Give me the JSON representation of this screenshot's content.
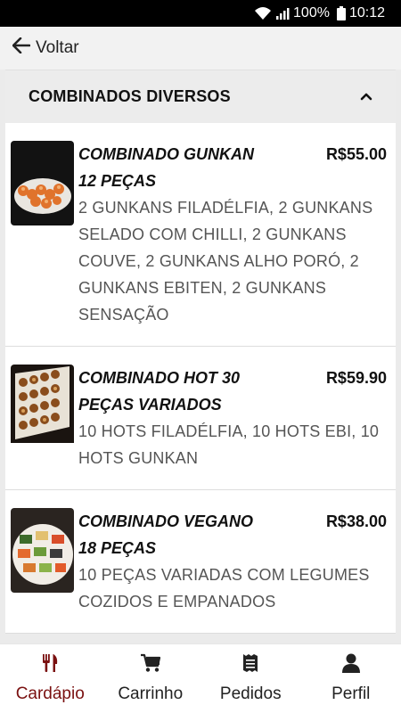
{
  "status_bar": {
    "battery": "100%",
    "time": "10:12"
  },
  "top_bar": {
    "back_label": "Voltar"
  },
  "section": {
    "title": "COMBINADOS DIVERSOS",
    "expanded": true
  },
  "items": [
    {
      "name": "COMBINADO GUNKAN 12 PEÇAS",
      "price": "R$55.00",
      "description": "2 GUNKANS FILADÉLFIA, 2 GUNKANS SELADO COM CHILLI, 2 GUNKANS COUVE, 2 GUNKANS ALHO PORÓ, 2 GUNKANS EBITEN, 2 GUNKANS SENSAÇÃO"
    },
    {
      "name": "COMBINADO HOT 30 PEÇAS VARIADOS",
      "price": "R$59.90",
      "description": "10 HOTS FILADÉLFIA, 10 HOTS EBI, 10 HOTS GUNKAN"
    },
    {
      "name": "COMBINADO VEGANO 18 PEÇAS",
      "price": "R$38.00",
      "description": "10 PEÇAS VARIADAS COM LEGUMES COZIDOS E EMPANADOS"
    }
  ],
  "bottom_nav": [
    {
      "label": "Cardápio",
      "icon": "utensils-icon",
      "active": true
    },
    {
      "label": "Carrinho",
      "icon": "cart-icon",
      "active": false
    },
    {
      "label": "Pedidos",
      "icon": "receipt-icon",
      "active": false
    },
    {
      "label": "Perfil",
      "icon": "user-icon",
      "active": false
    }
  ],
  "colors": {
    "active_nav": "#7a1010",
    "header_bg": "#ececec"
  }
}
